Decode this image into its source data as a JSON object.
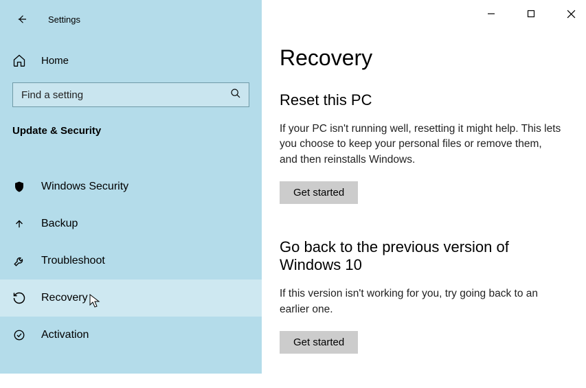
{
  "window": {
    "title": "Settings"
  },
  "sidebar": {
    "home_label": "Home",
    "search_placeholder": "Find a setting",
    "category_label": "Update & Security",
    "items": [
      {
        "icon": "shield-icon",
        "label": "Windows Security"
      },
      {
        "icon": "backup-icon",
        "label": "Backup"
      },
      {
        "icon": "troubleshoot-icon",
        "label": "Troubleshoot"
      },
      {
        "icon": "recovery-icon",
        "label": "Recovery"
      },
      {
        "icon": "activation-icon",
        "label": "Activation"
      }
    ]
  },
  "page": {
    "heading": "Recovery",
    "sections": [
      {
        "title": "Reset this PC",
        "desc": "If your PC isn't running well, resetting it might help. This lets you choose to keep your personal files or remove them, and then reinstalls Windows.",
        "button": "Get started"
      },
      {
        "title": "Go back to the previous version of Windows 10",
        "desc": "If this version isn't working for you, try going back to an earlier one.",
        "button": "Get started"
      }
    ]
  }
}
